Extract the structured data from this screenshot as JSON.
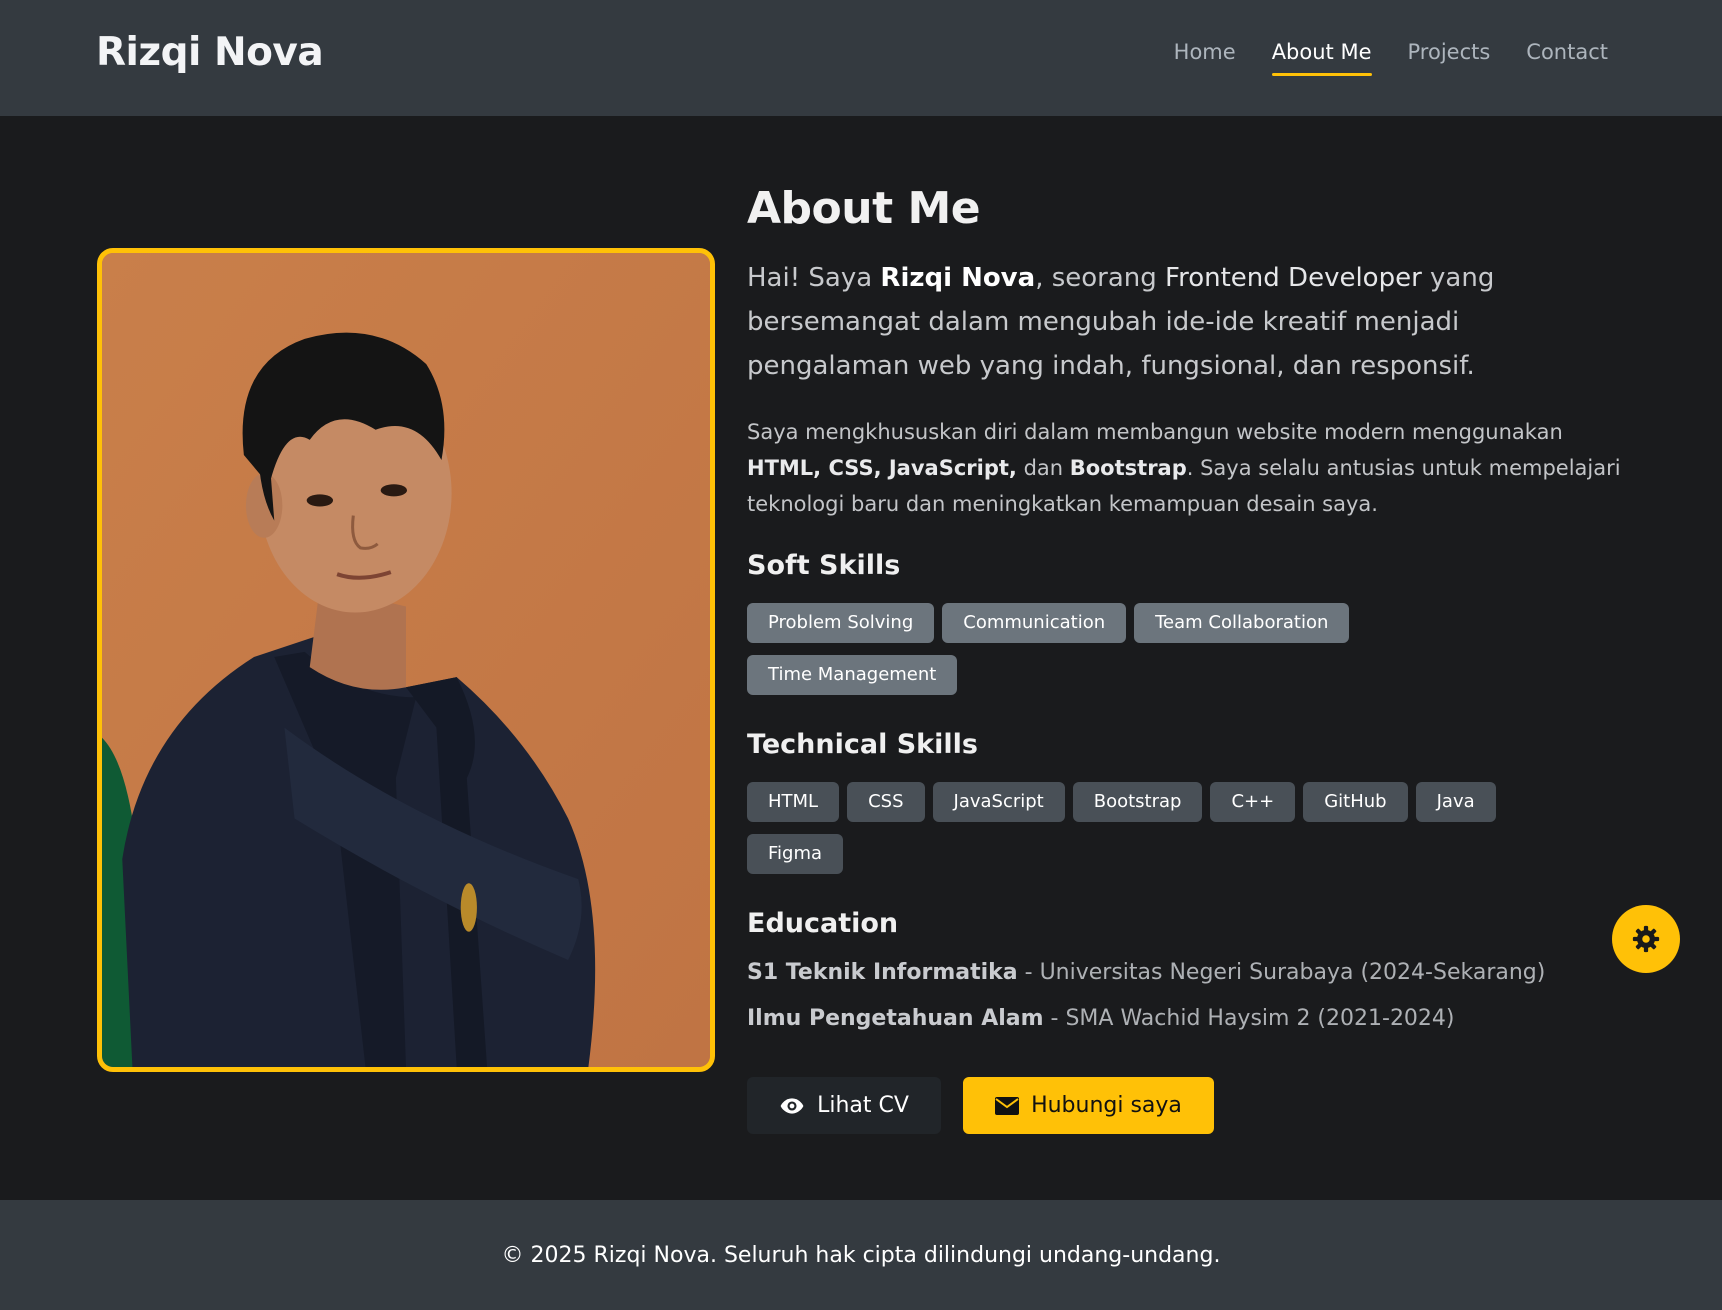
{
  "navbar": {
    "brand": "Rizqi Nova",
    "links": [
      {
        "label": "Home",
        "active": false
      },
      {
        "label": "About Me",
        "active": true
      },
      {
        "label": "Projects",
        "active": false
      },
      {
        "label": "Contact",
        "active": false
      }
    ]
  },
  "about": {
    "title": "About Me",
    "lead": {
      "intro": "Hai! Saya ",
      "name": "Rizqi Nova",
      "mid": ", seorang ",
      "role": "Frontend Developer",
      "rest": " yang bersemangat dalam mengubah ide-ide kreatif menjadi pengalaman web yang indah, fungsional, dan responsif."
    },
    "paragraph": {
      "start": "Saya mengkhususkan diri dalam membangun website modern menggunakan ",
      "tech": "HTML, CSS, JavaScript,",
      "and": " dan ",
      "framework": "Bootstrap",
      "end": ". Saya selalu antusias untuk mempelajari teknologi baru dan meningkatkan kemampuan desain saya."
    },
    "soft_skills": {
      "title": "Soft Skills",
      "items": [
        "Problem Solving",
        "Communication",
        "Team Collaboration",
        "Time Management"
      ]
    },
    "technical_skills": {
      "title": "Technical Skills",
      "items": [
        "HTML",
        "CSS",
        "JavaScript",
        "Bootstrap",
        "C++",
        "GitHub",
        "Java",
        "Figma"
      ]
    },
    "education": {
      "title": "Education",
      "entries": [
        {
          "degree": "S1 Teknik Informatika",
          "detail": " - Universitas Negeri Surabaya (2024-Sekarang)"
        },
        {
          "degree": "Ilmu Pengetahuan Alam",
          "detail": " - SMA Wachid Haysim 2 (2021-2024)"
        }
      ]
    },
    "buttons": {
      "cv": "Lihat CV",
      "contact": "Hubungi saya"
    }
  },
  "footer": {
    "text": "© 2025 Rizqi Nova. Seluruh hak cipta dilindungi undang-undang."
  },
  "icons": {
    "cv_icon": "eye-icon",
    "contact_icon": "envelope-icon",
    "fab_icon": "gear-icon"
  },
  "colors": {
    "accent": "#ffc107",
    "navbar_bg": "#343a40",
    "page_bg": "#1a1b1d",
    "soft_pill": "#6c757d",
    "tech_pill": "#495057",
    "photo_bg": "#c77c47"
  }
}
